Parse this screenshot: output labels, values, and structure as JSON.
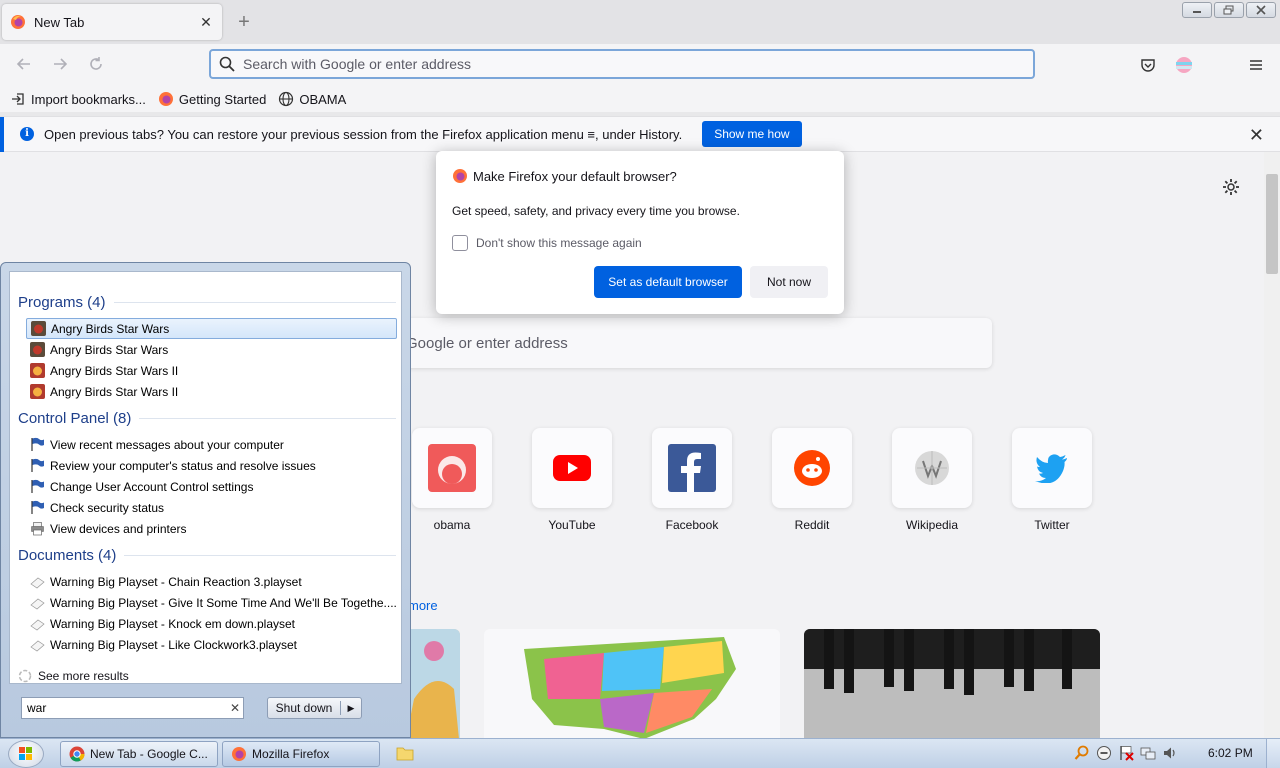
{
  "browser": {
    "tab": {
      "title": "New Tab"
    },
    "new_tab_symbol": "+",
    "url_placeholder": "Search with Google or enter address",
    "bookmarks": [
      {
        "label": "Import bookmarks...",
        "icon": "import-icon"
      },
      {
        "label": "Getting Started",
        "icon": "firefox-icon"
      },
      {
        "label": "OBAMA",
        "icon": "globe-icon"
      }
    ],
    "notification": {
      "text": "Open previous tabs? You can restore your previous session from the Firefox application menu ≡, under History.",
      "button": "Show me how"
    }
  },
  "page": {
    "search_placeholder": "Google or enter address",
    "shortcuts": [
      {
        "label": "obama",
        "icon": "obama-icon"
      },
      {
        "label": "YouTube",
        "icon": "youtube-icon"
      },
      {
        "label": "Facebook",
        "icon": "facebook-icon"
      },
      {
        "label": "Reddit",
        "icon": "reddit-icon"
      },
      {
        "label": "Wikipedia",
        "icon": "wikipedia-icon"
      },
      {
        "label": "Twitter",
        "icon": "twitter-icon"
      }
    ],
    "more_link": "more"
  },
  "dialog": {
    "title": "Make Firefox your default browser?",
    "body": "Get speed, safety, and privacy every time you browse.",
    "checkbox": "Don't show this message again",
    "primary": "Set as default browser",
    "secondary": "Not now"
  },
  "startmenu": {
    "groups": [
      {
        "title": "Programs (4)",
        "items": [
          {
            "label": "Angry Birds Star Wars",
            "icon": "angry-birds-icon",
            "selected": true
          },
          {
            "label": "Angry Birds Star Wars",
            "icon": "angry-birds-icon"
          },
          {
            "label": "Angry Birds Star Wars II",
            "icon": "angry-birds-ii-icon"
          },
          {
            "label": "Angry Birds Star Wars II",
            "icon": "angry-birds-ii-icon"
          }
        ]
      },
      {
        "title": "Control Panel (8)",
        "items": [
          {
            "label": "View recent messages about your computer",
            "icon": "action-center-flag-icon"
          },
          {
            "label": "Review your computer's status and resolve issues",
            "icon": "action-center-flag-icon"
          },
          {
            "label": "Change User Account Control settings",
            "icon": "action-center-flag-icon"
          },
          {
            "label": "Check security status",
            "icon": "action-center-flag-icon"
          },
          {
            "label": "View devices and printers",
            "icon": "printer-icon"
          }
        ]
      },
      {
        "title": "Documents (4)",
        "items": [
          {
            "label": "Warning Big Playset - Chain Reaction 3.playset",
            "icon": "playset-file-icon"
          },
          {
            "label": "Warning Big Playset - Give It Some Time And We'll Be Togethe....",
            "icon": "playset-file-icon"
          },
          {
            "label": "Warning Big Playset - Knock em down.playset",
            "icon": "playset-file-icon"
          },
          {
            "label": "Warning Big Playset - Like Clockwork3.playset",
            "icon": "playset-file-icon"
          }
        ]
      }
    ],
    "see_more": "See more results",
    "search_value": "war",
    "shutdown": "Shut down"
  },
  "taskbar": {
    "tasks": [
      {
        "label": "New Tab - Google C...",
        "icon": "chrome-icon"
      },
      {
        "label": "Mozilla Firefox",
        "icon": "firefox-icon"
      }
    ],
    "clock": "6:02 PM"
  },
  "colors": {
    "accent": "#0061e0",
    "start_group_title": "#1e3f8a"
  }
}
